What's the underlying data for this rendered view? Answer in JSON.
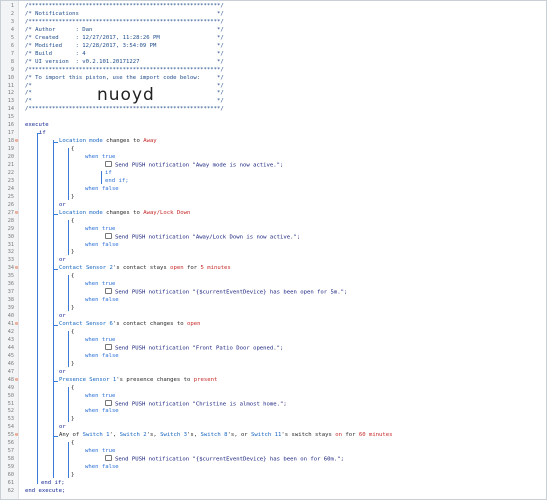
{
  "editor": {
    "import_code": "nuoyd",
    "header_lines": [
      "/*********************************************************/",
      "/* Notifications                                         */",
      "/*********************************************************/",
      "/* Author      : Dan                                     */",
      "/* Created     : 12/27/2017, 11:28:26 PM                 */",
      "/* Modified    : 12/28/2017, 3:54:09 PM                  */",
      "/* Build       : 4                                       */",
      "/* UI version  : v0.2.101.20171227                       */",
      "/*********************************************************/",
      "/* To import this piston, use the import code below:     */",
      "/*                                                       */",
      "/*                                                       */",
      "/*                                                       */",
      "/*********************************************************/"
    ],
    "kw": {
      "execute": "execute",
      "if": "if",
      "or": "or",
      "end_if": "end if;",
      "end_execute": "end execute;",
      "when_true": "when true",
      "when_false": "when false",
      "if_inner": "if",
      "end_if_inner": "end if;"
    },
    "conditions": [
      {
        "device": "Location mode",
        "op": " changes to ",
        "value": "Away",
        "note": "Send PUSH notification \"Away mode is now active.\";"
      },
      {
        "device": "Location mode",
        "op": " changes to ",
        "value": "Away/Lock Down",
        "note": "Send PUSH notification \"Away/Lock Down is now active.\";"
      },
      {
        "device": "Contact Sensor 2",
        "op": "'s contact stays ",
        "value": "open",
        "op2": " for ",
        "value2": "5 minutes",
        "note": "Send PUSH notification \"{$currentEventDevice} has been open for 5m.\";"
      },
      {
        "device": "Contact Sensor 6",
        "op": "'s contact changes to ",
        "value": "open",
        "note": "Send PUSH notification \"Front Patio Door opened.\";"
      },
      {
        "device": "Presence Sensor 1",
        "op": "'s presence changes to ",
        "value": "present",
        "note": "Send PUSH notification \"Christine is almost home.\";"
      }
    ],
    "switch_line": {
      "prefix": "Any of ",
      "s1": "Switch 1",
      "c1": "', ",
      "s2": "Switch 2",
      "c2": "'s, ",
      "s3": "Switch 3",
      "c3": "'s, ",
      "s4": "Switch 8",
      "c4": "'s, or ",
      "s5": "Switch 11",
      "tail": "'s switch stays ",
      "val": "on",
      "for": " for ",
      "dur": "60 minutes",
      "note": "Send PUSH notification \"{$currentEventDevice} has been on for 60m.\";"
    },
    "brace_open": "{",
    "brace_close": "}",
    "line_numbers": [
      "1",
      "2",
      "3",
      "4",
      "5",
      "6",
      "7",
      "8",
      "9",
      "10",
      "11",
      "12",
      "13",
      "14",
      "15",
      "16",
      "17",
      "18",
      "19",
      "20",
      "21",
      "22",
      "23",
      "24",
      "25",
      "26",
      "27",
      "28",
      "29",
      "30",
      "31",
      "32",
      "33",
      "34",
      "35",
      "36",
      "37",
      "38",
      "39",
      "40",
      "41",
      "42",
      "43",
      "44",
      "45",
      "46",
      "47",
      "48",
      "49",
      "50",
      "51",
      "52",
      "53",
      "54",
      "55",
      "56",
      "57",
      "58",
      "59",
      "60",
      "61",
      "62"
    ],
    "fold_marker": "⊖"
  }
}
